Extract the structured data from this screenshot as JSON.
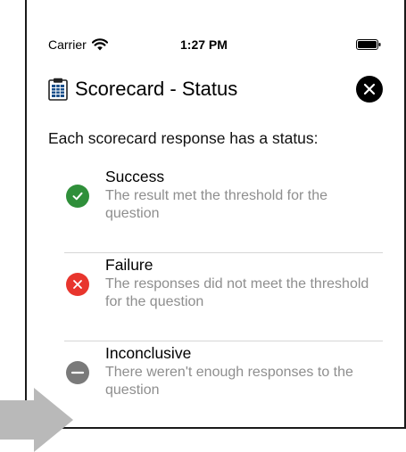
{
  "status_bar": {
    "carrier": "Carrier",
    "time": "1:27 PM",
    "wifi_icon": "wifi-icon",
    "battery_icon": "battery-icon"
  },
  "header": {
    "icon": "clipboard-icon",
    "title": "Scorecard - Status",
    "close_icon": "close-icon"
  },
  "intro": "Each scorecard response has a status:",
  "statuses": [
    {
      "title": "Success",
      "description": "The result met the threshold for the question",
      "icon": "checkmark-icon",
      "color": "#2f8f3a"
    },
    {
      "title": "Failure",
      "description": "The responses did not meet the threshold for the question",
      "icon": "x-icon",
      "color": "#e8352d"
    },
    {
      "title": "Inconclusive",
      "description": "There weren't enough responses to the question",
      "icon": "minus-icon",
      "color": "#7a7a7a"
    }
  ],
  "colors": {
    "divider": "#d6d6d6",
    "secondary_text": "#8e8e8e",
    "arrow": "#b9b9b9"
  }
}
